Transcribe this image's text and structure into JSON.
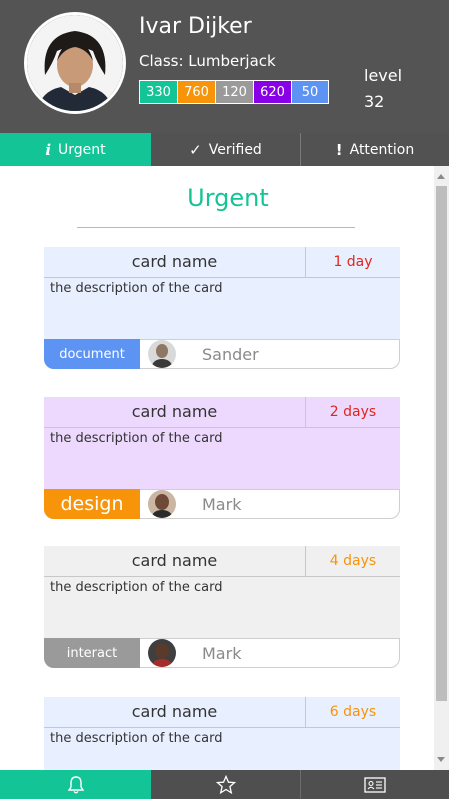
{
  "profile": {
    "name": "Ivar Dijker",
    "class_text": "Class: Lumberjack",
    "level_label": "level",
    "level_value": "32",
    "stats": [
      {
        "value": "330",
        "color": "#13c596"
      },
      {
        "value": "760",
        "color": "#f7940a"
      },
      {
        "value": "120",
        "color": "#9a9a9a"
      },
      {
        "value": "620",
        "color": "#8a00e6"
      },
      {
        "value": "50",
        "color": "#5d93f3"
      }
    ]
  },
  "tabs": [
    {
      "label": "Urgent",
      "icon": "info-icon",
      "active": true
    },
    {
      "label": "Verified",
      "icon": "check-icon",
      "active": false
    },
    {
      "label": "Attention",
      "icon": "exclamation-icon",
      "active": false
    }
  ],
  "section": {
    "title": "Urgent"
  },
  "cards": [
    {
      "name": "card name",
      "due": "1 day",
      "due_color": "#e0261f",
      "description": "the description of the card",
      "bg": "#e8efff",
      "tag": {
        "label": "document",
        "color": "#5d93f3"
      },
      "assignee": "Sander"
    },
    {
      "name": "card name",
      "due": "2 days",
      "due_color": "#e0261f",
      "description": "the description of the card",
      "bg": "#edd9fd",
      "tag": {
        "label": "design",
        "color": "#f7940a"
      },
      "assignee": "Mark"
    },
    {
      "name": "card name",
      "due": "4 days",
      "due_color": "#f7940a",
      "description": "the description of the card",
      "bg": "#f0f0f0",
      "tag": {
        "label": "interact",
        "color": "#9a9a9a"
      },
      "assignee": "Mark"
    },
    {
      "name": "card name",
      "due": "6 days",
      "due_color": "#f7940a",
      "description": "the description of the card",
      "bg": "#e8efff"
    }
  ],
  "bottom_nav": [
    {
      "icon": "bell-icon",
      "active": true
    },
    {
      "icon": "star-icon",
      "active": false
    },
    {
      "icon": "id-card-icon",
      "active": false
    }
  ]
}
